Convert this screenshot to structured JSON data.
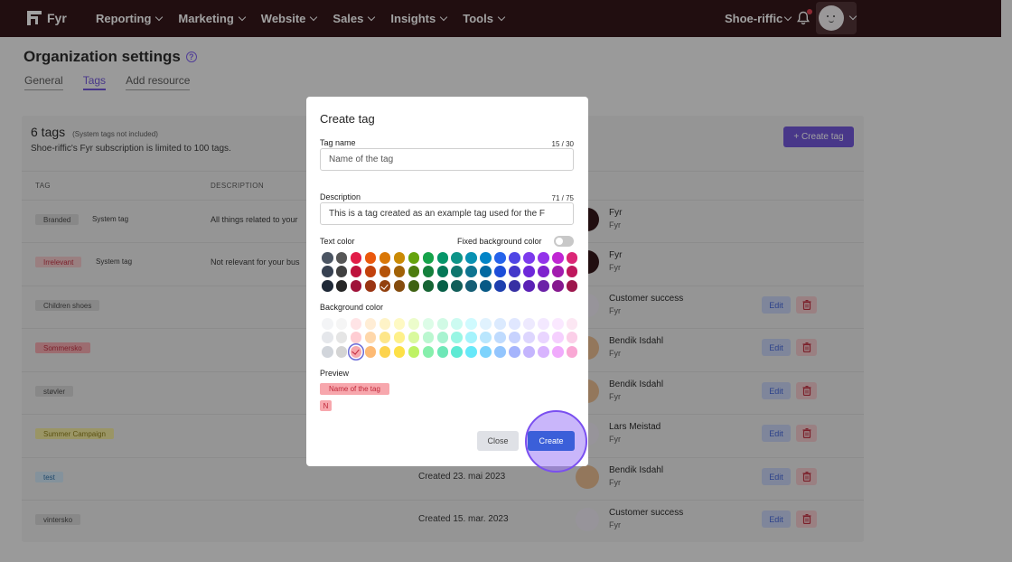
{
  "nav": {
    "brand": "Fyr",
    "items": [
      "Reporting",
      "Marketing",
      "Website",
      "Sales",
      "Insights",
      "Tools"
    ],
    "org": "Shoe-riffic"
  },
  "page": {
    "title": "Organization settings",
    "tabs": [
      "General",
      "Tags",
      "Add resource"
    ],
    "active_tab": "Tags"
  },
  "tags_card": {
    "count": "6 tags",
    "count_note": "(System tags not included)",
    "limit_text": "Shoe-riffic's Fyr subscription is limited to 100 tags.",
    "create_button": "+ Create tag",
    "columns": {
      "tag": "TAG",
      "description": "DESCRIPTION"
    },
    "rows": [
      {
        "tag": "Branded",
        "system": "System tag",
        "description": "All things related to your",
        "created": "",
        "owner": "Fyr",
        "owner_org": "Fyr",
        "pill_bg": "#d6d6d6",
        "pill_fg": "#444444",
        "avatar": "fyr"
      },
      {
        "tag": "Irrelevant",
        "system": "System tag",
        "description": "Not relevant for your bus",
        "created": "",
        "owner": "Fyr",
        "owner_org": "Fyr",
        "pill_bg": "#f3c6c9",
        "pill_fg": "#c0283a",
        "avatar": "fyr"
      },
      {
        "tag": "Children shoes",
        "system": "",
        "description": "",
        "created": "",
        "owner": "Customer success",
        "owner_org": "Fyr",
        "pill_bg": "#d6d6d6",
        "pill_fg": "#444444",
        "avatar": "face-light",
        "edit": "Edit"
      },
      {
        "tag": "Sommersko",
        "system": "",
        "description": "",
        "created": "",
        "owner": "Bendik Isdahl",
        "owner_org": "Fyr",
        "pill_bg": "#f7a7ad",
        "pill_fg": "#c0283a",
        "avatar": "face-tan",
        "edit": "Edit"
      },
      {
        "tag": "støvler",
        "system": "",
        "description": "",
        "created": "",
        "owner": "Bendik Isdahl",
        "owner_org": "Fyr",
        "pill_bg": "#d6d6d6",
        "pill_fg": "#444444",
        "avatar": "face-tan",
        "edit": "Edit"
      },
      {
        "tag": "Summer Campaign",
        "system": "",
        "description": "",
        "created": "",
        "owner": "Lars Meistad",
        "owner_org": "Fyr",
        "pill_bg": "#f4ec9c",
        "pill_fg": "#8a7a10",
        "avatar": "face-light",
        "edit": "Edit"
      },
      {
        "tag": "test",
        "system": "",
        "description": "",
        "created": "Created 23. mai 2023",
        "owner": "Bendik Isdahl",
        "owner_org": "Fyr",
        "pill_bg": "#cfe6f7",
        "pill_fg": "#2b6ea8",
        "avatar": "face-tan",
        "edit": "Edit"
      },
      {
        "tag": "vintersko",
        "system": "",
        "description": "",
        "created": "Created 15. mar. 2023",
        "owner": "Customer success",
        "owner_org": "Fyr",
        "pill_bg": "#d6d6d6",
        "pill_fg": "#444444",
        "avatar": "face-light",
        "edit": "Edit"
      }
    ]
  },
  "modal": {
    "title": "Create tag",
    "name_label": "Tag name",
    "name_count": "15 / 30",
    "name_placeholder": "Name of the tag",
    "description_label": "Description",
    "description_count": "71 / 75",
    "description_value": "This is a tag created as an example tag used for the F",
    "text_color_label": "Text color",
    "fixed_bg_label": "Fixed background color",
    "fixed_bg_enabled": false,
    "background_color_label": "Background color",
    "preview_label": "Preview",
    "preview_text": "Name of the tag",
    "preview_mini": "N",
    "close_button": "Close",
    "create_button": "Create",
    "text_palette": [
      [
        "#4b5563",
        "#565656",
        "#e11d48",
        "#ea580c",
        "#d97706",
        "#ca8a04",
        "#65a30d",
        "#16a34a",
        "#059669",
        "#0d9488",
        "#0891b2",
        "#0284c7",
        "#2563eb",
        "#4f46e5",
        "#7c3aed",
        "#9333ea",
        "#c026d3",
        "#db2777"
      ],
      [
        "#374151",
        "#404040",
        "#be123c",
        "#c2410c",
        "#b45309",
        "#a16207",
        "#4d7c0f",
        "#15803d",
        "#047857",
        "#0f766e",
        "#0e7490",
        "#0369a1",
        "#1d4ed8",
        "#4338ca",
        "#6d28d9",
        "#7e22ce",
        "#a21caf",
        "#be185d"
      ],
      [
        "#1f2937",
        "#262626",
        "#9f1239",
        "#9a3412",
        "#92400e",
        "#854d0e",
        "#3f6212",
        "#166534",
        "#065f46",
        "#115e59",
        "#155e75",
        "#075985",
        "#1e40af",
        "#3730a3",
        "#5b21b6",
        "#6b21a8",
        "#86198f",
        "#9d174d"
      ]
    ],
    "text_selected_index": [
      2,
      4
    ],
    "bg_palette": [
      [
        "#f3f4f6",
        "#f5f5f5",
        "#ffe4e6",
        "#ffedd5",
        "#fef3c7",
        "#fef9c3",
        "#ecfccb",
        "#dcfce7",
        "#d1fae5",
        "#ccfbf1",
        "#cffafe",
        "#e0f2fe",
        "#dbeafe",
        "#e0e7ff",
        "#ede9fe",
        "#f3e8ff",
        "#fae8ff",
        "#fce7f3"
      ],
      [
        "#e5e7eb",
        "#e5e5e5",
        "#fecdd3",
        "#fed7aa",
        "#fde68a",
        "#fef08a",
        "#d9f99d",
        "#bbf7d0",
        "#a7f3d0",
        "#99f6e4",
        "#a5f3fc",
        "#bae6fd",
        "#bfdbfe",
        "#c7d2fe",
        "#ddd6fe",
        "#e9d5ff",
        "#f5d0fe",
        "#fbcfe8"
      ],
      [
        "#d1d5db",
        "#d4d4d4",
        "#f7a7ad",
        "#fdba74",
        "#fcd34d",
        "#fde047",
        "#bef264",
        "#86efac",
        "#6ee7b7",
        "#5eead4",
        "#67e8f9",
        "#7dd3fc",
        "#93c5fd",
        "#a5b4fc",
        "#c4b5fd",
        "#d8b4fe",
        "#f0abfc",
        "#f9a8d4"
      ]
    ],
    "bg_selected_index": [
      2,
      2
    ]
  }
}
